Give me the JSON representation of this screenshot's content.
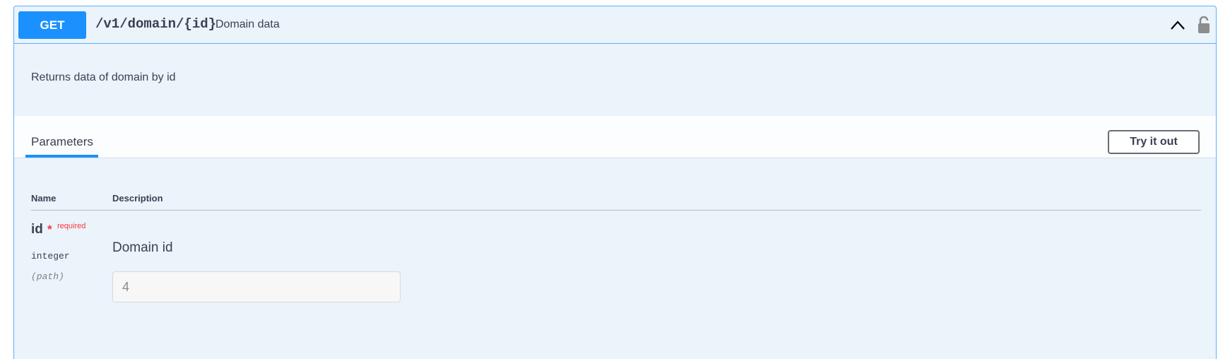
{
  "operation": {
    "method": "GET",
    "path": "/v1/domain/{id}",
    "summary": "Domain data",
    "description": "Returns data of domain by id",
    "collapse_icon": "chevron-up-icon",
    "lock_icon": "unlocked-padlock-icon"
  },
  "parameters_section": {
    "tab_label": "Parameters",
    "try_button_label": "Try it out",
    "columns": [
      "Name",
      "Description"
    ]
  },
  "parameters": [
    {
      "name": "id",
      "required_marker": "*",
      "required_label": "required",
      "type": "integer",
      "in": "(path)",
      "description": "Domain id",
      "input_placeholder": "4"
    }
  ],
  "colors": {
    "get_accent": "#1a91ff",
    "block_border": "#61affe",
    "block_bg": "#ebf3fb",
    "required": "#ff3636"
  }
}
